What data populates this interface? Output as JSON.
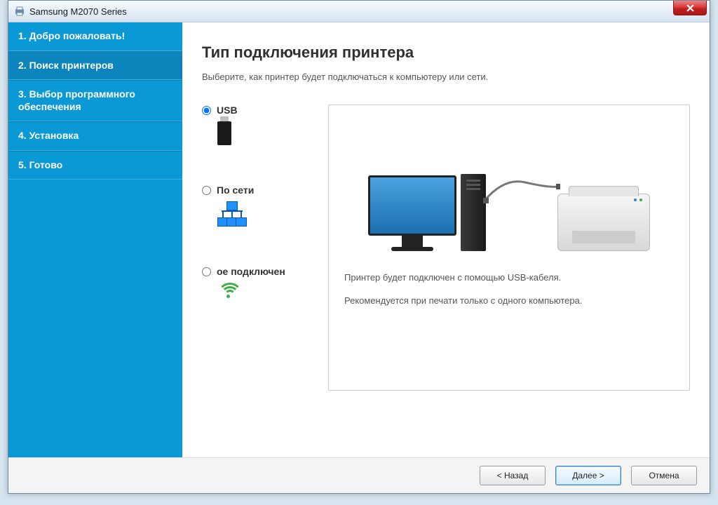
{
  "window": {
    "title": "Samsung M2070 Series"
  },
  "sidebar": {
    "items": [
      {
        "label": "1. Добро пожаловать!"
      },
      {
        "label": "2. Поиск принтеров"
      },
      {
        "label": "3. Выбор программного обеспечения"
      },
      {
        "label": "4. Установка"
      },
      {
        "label": "5. Готово"
      }
    ],
    "active_index": 1
  },
  "main": {
    "heading": "Тип подключения принтера",
    "subheading": "Выберите, как принтер будет подключаться к компьютеру или сети."
  },
  "options": {
    "usb": {
      "label": "USB",
      "selected": true
    },
    "network": {
      "label": "По сети",
      "selected": false
    },
    "wireless": {
      "label": "ое подключен",
      "selected": false
    }
  },
  "description": {
    "line1": "Принтер будет подключен с помощью USB-кабеля.",
    "line2": "Рекомендуется при печати только с одного компьютера."
  },
  "footer": {
    "back": "< Назад",
    "next": "Далее >",
    "cancel": "Отмена"
  }
}
